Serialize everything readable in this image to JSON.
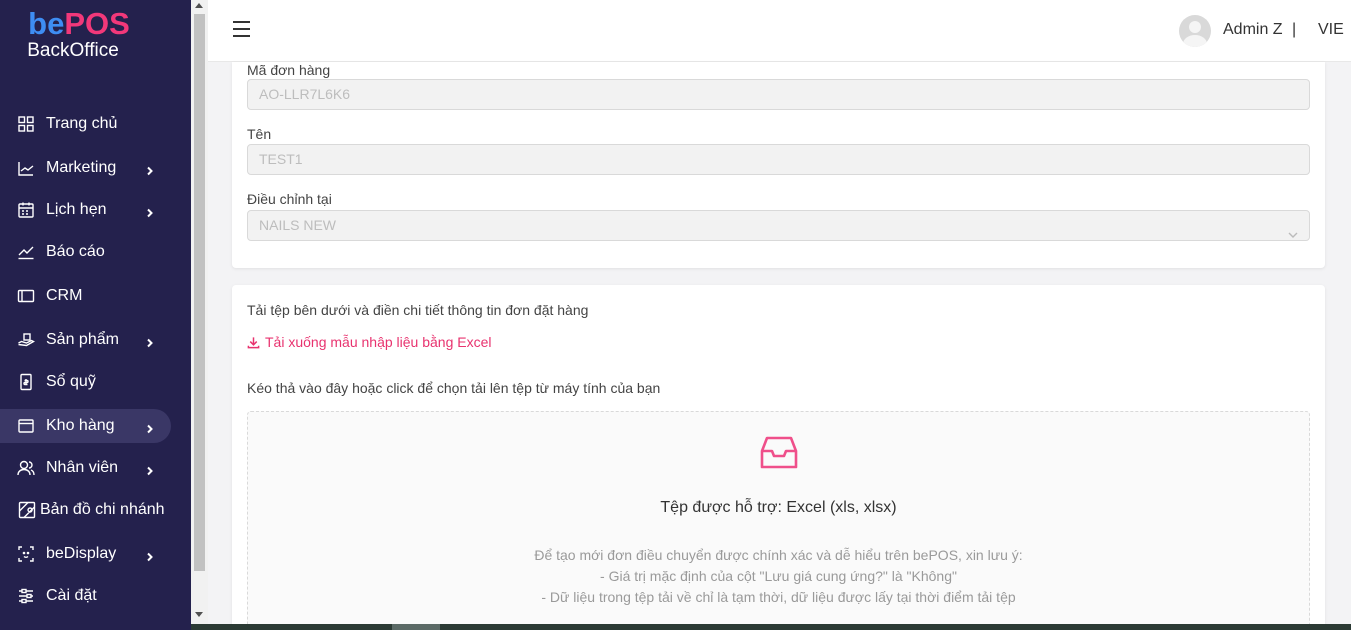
{
  "logo": {
    "be": "be",
    "pos": "POS",
    "sub": "BackOffice"
  },
  "sidebar": {
    "items": [
      {
        "label": "Trang chủ",
        "icon": "grid-icon",
        "chevron": false,
        "active": false
      },
      {
        "label": "Marketing",
        "icon": "chart-line-icon",
        "chevron": true,
        "active": false
      },
      {
        "label": "Lịch hẹn",
        "icon": "calendar-icon",
        "chevron": true,
        "active": false
      },
      {
        "label": "Báo cáo",
        "icon": "trend-icon",
        "chevron": false,
        "active": false
      },
      {
        "label": "CRM",
        "icon": "id-card-icon",
        "chevron": false,
        "active": false
      },
      {
        "label": "Sản phẩm",
        "icon": "hand-product-icon",
        "chevron": true,
        "active": false
      },
      {
        "label": "Sổ quỹ",
        "icon": "cash-book-icon",
        "chevron": false,
        "active": false
      },
      {
        "label": "Kho hàng",
        "icon": "warehouse-icon",
        "chevron": true,
        "active": true
      },
      {
        "label": "Nhân viên",
        "icon": "users-icon",
        "chevron": true,
        "active": false
      },
      {
        "label": "Bản đồ chi nhánh",
        "icon": "map-icon",
        "chevron": false,
        "active": false
      },
      {
        "label": "beDisplay",
        "icon": "face-scan-icon",
        "chevron": true,
        "active": false
      },
      {
        "label": "Cài đặt",
        "icon": "sliders-icon",
        "chevron": false,
        "active": false
      }
    ]
  },
  "header": {
    "user_name": "Admin Z",
    "separator": "|",
    "language": "VIE"
  },
  "form": {
    "order_code_label": "Mã đơn hàng",
    "order_code_value": "AO-LLR7L6K6",
    "name_label": "Tên",
    "name_value": "TEST1",
    "adjust_at_label": "Điều chỉnh tại",
    "adjust_at_value": "NAILS NEW"
  },
  "upload": {
    "instruction": "Tải tệp bên dưới và điền chi tiết thông tin đơn đặt hàng",
    "download_link": "Tải xuống mẫu nhập liệu bằng Excel",
    "drag_hint": "Kéo thả vào đây hoặc click để chọn tải lên tệp từ máy tính của bạn",
    "supported": "Tệp được hỗ trợ: Excel (xls, xlsx)",
    "note_1": "Để tạo mới đơn điều chuyển được chính xác và dễ hiểu trên bePOS, xin lưu ý:",
    "note_2": "- Giá trị mặc định của cột \"Lưu giá cung ứng?\" là \"Không\"",
    "note_3": "- Dữ liệu trong tệp tải về chỉ là tạm thời, dữ liệu được lấy tại thời điểm tải tệp"
  },
  "colors": {
    "sidebar_bg": "#24214d",
    "accent_pink": "#e8336f",
    "brand_blue": "#3e8df3"
  }
}
